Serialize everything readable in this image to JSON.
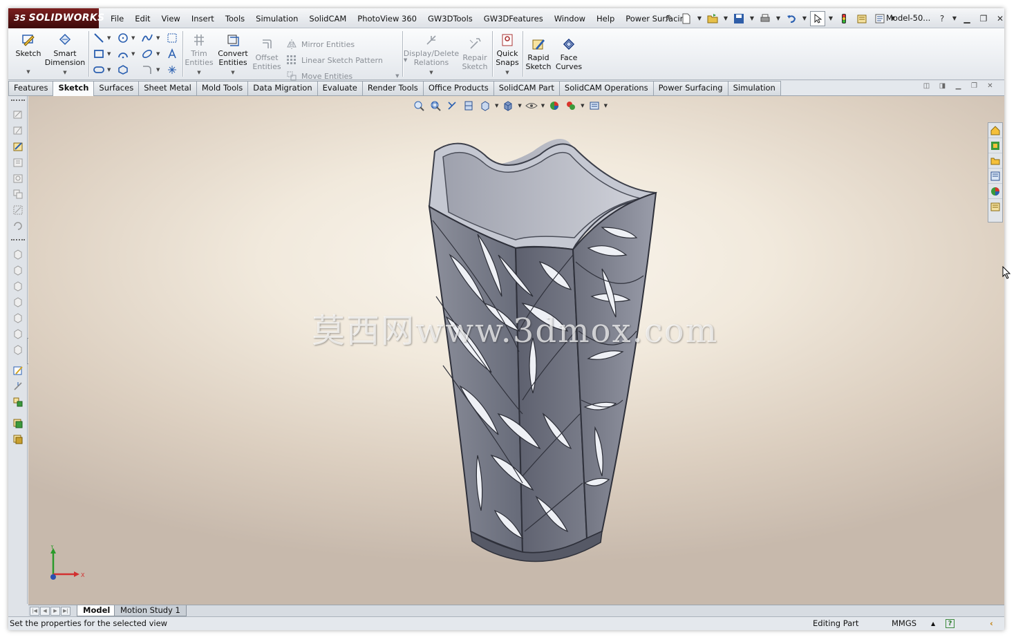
{
  "app": {
    "brand": "SOLIDWORKS",
    "brand_prefix": "3S",
    "doc_title": "Model-50..."
  },
  "menu": [
    "File",
    "Edit",
    "View",
    "Insert",
    "Tools",
    "Simulation",
    "SolidCAM",
    "PhotoView 360",
    "GW3DTools",
    "GW3DFeatures",
    "Window",
    "Help",
    "Power Surfacing"
  ],
  "ribbon": {
    "sketch": "Sketch",
    "smart_dimension": "Smart\nDimension",
    "trim": "Trim\nEntities",
    "convert": "Convert\nEntities",
    "offset": "Offset\nEntities",
    "mirror": "Mirror Entities",
    "linear_pattern": "Linear Sketch Pattern",
    "move": "Move Entities",
    "display_relations": "Display/Delete\nRelations",
    "repair": "Repair\nSketch",
    "quick_snaps": "Quick\nSnaps",
    "rapid_sketch": "Rapid\nSketch",
    "face_curves": "Face\nCurves"
  },
  "tabs": [
    "Features",
    "Sketch",
    "Surfaces",
    "Sheet Metal",
    "Mold Tools",
    "Data Migration",
    "Evaluate",
    "Render Tools",
    "Office Products",
    "SolidCAM Part",
    "SolidCAM Operations",
    "Power Surfacing",
    "Simulation"
  ],
  "active_tab": "Sketch",
  "watermark": "莫西网www.3dmox.com",
  "triad": {
    "x": "X",
    "y": "Y"
  },
  "bottom_tabs": {
    "model": "Model",
    "motion": "Motion Study 1"
  },
  "status": {
    "message": "Set the properties for the selected view",
    "mode": "Editing Part",
    "units": "MMGS",
    "help": "?"
  },
  "colors": {
    "accent": "#2a4f8f",
    "brand": "#7a1f1f",
    "model": "#6e7180"
  }
}
